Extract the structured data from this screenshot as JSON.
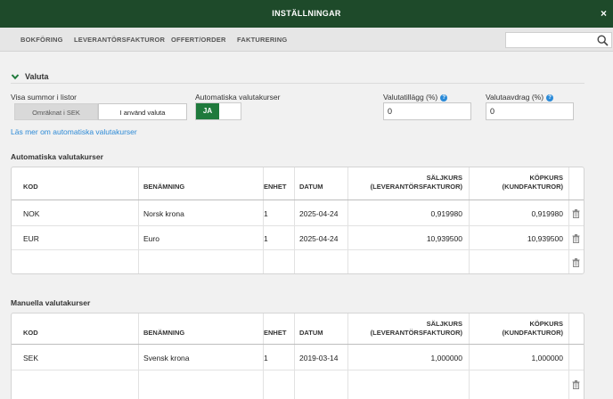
{
  "window": {
    "title": "INSTÄLLNINGAR",
    "close": "×"
  },
  "tabs": [
    "BOKFÖRING",
    "LEVERANTÖRSFAKTUROR",
    "OFFERT/ORDER",
    "FAKTURERING"
  ],
  "search": {
    "value": "",
    "placeholder": ""
  },
  "section": {
    "title": "Valuta"
  },
  "form": {
    "show_sums_label": "Visa summor i listor",
    "option_converted": "Omräknat i SEK",
    "option_currency": "I använd valuta",
    "auto_rates_label": "Automatiska valutakurser",
    "toggle_on": "JA",
    "surcharge_label": "Valutatillägg (%)",
    "surcharge_value": "0",
    "deduction_label": "Valutaavdrag (%)",
    "deduction_value": "0",
    "help": "?",
    "link": "Läs mer om automatiska valutakurser"
  },
  "headers": {
    "kod": "KOD",
    "benamning": "BENÄMNING",
    "enhet": "ENHET",
    "datum": "DATUM",
    "saljkurs1": "SÄLJKURS",
    "saljkurs2": "(LEVERANTÖRSFAKTUROR)",
    "kopkurs1": "KÖPKURS",
    "kopkurs2": "(KUNDFAKTUROR)"
  },
  "auto_table": {
    "title": "Automatiska valutakurser",
    "rows": [
      {
        "kod": "NOK",
        "benamning": "Norsk krona",
        "enhet": "1",
        "datum": "2025-04-24",
        "saljkurs": "0,919980",
        "kopkurs": "0,919980"
      },
      {
        "kod": "EUR",
        "benamning": "Euro",
        "enhet": "1",
        "datum": "2025-04-24",
        "saljkurs": "10,939500",
        "kopkurs": "10,939500"
      }
    ]
  },
  "manual_table": {
    "title": "Manuella valutakurser",
    "rows": [
      {
        "kod": "SEK",
        "benamning": "Svensk krona",
        "enhet": "1",
        "datum": "2019-03-14",
        "saljkurs": "1,000000",
        "kopkurs": "1,000000"
      }
    ]
  },
  "icons": {
    "close": "close-icon",
    "search": "search-icon",
    "chevron": "chevron-down-icon",
    "help": "help-icon",
    "trash": "trash-icon"
  },
  "colors": {
    "titlebar": "#1e4a2a",
    "toggle_on": "#1f7a3c",
    "link": "#2d8ad6"
  }
}
